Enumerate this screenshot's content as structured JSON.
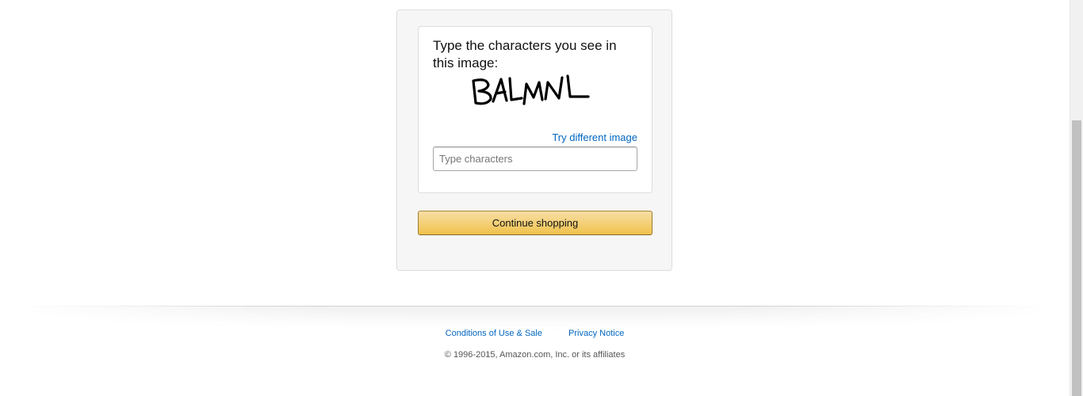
{
  "captcha_form": {
    "prompt": "Type the characters you see in this image:",
    "captcha_text": "BALMNL",
    "try_different_label": "Try different image",
    "input_placeholder": "Type characters",
    "input_value": "",
    "continue_label": "Continue shopping"
  },
  "footer": {
    "links": [
      {
        "label": "Conditions of Use & Sale"
      },
      {
        "label": "Privacy Notice"
      }
    ],
    "copyright": "© 1996-2015, Amazon.com, Inc. or its affiliates"
  },
  "colors": {
    "link": "#0066c0",
    "button_top": "#f7dfa5",
    "button_bottom": "#f0c14b"
  }
}
